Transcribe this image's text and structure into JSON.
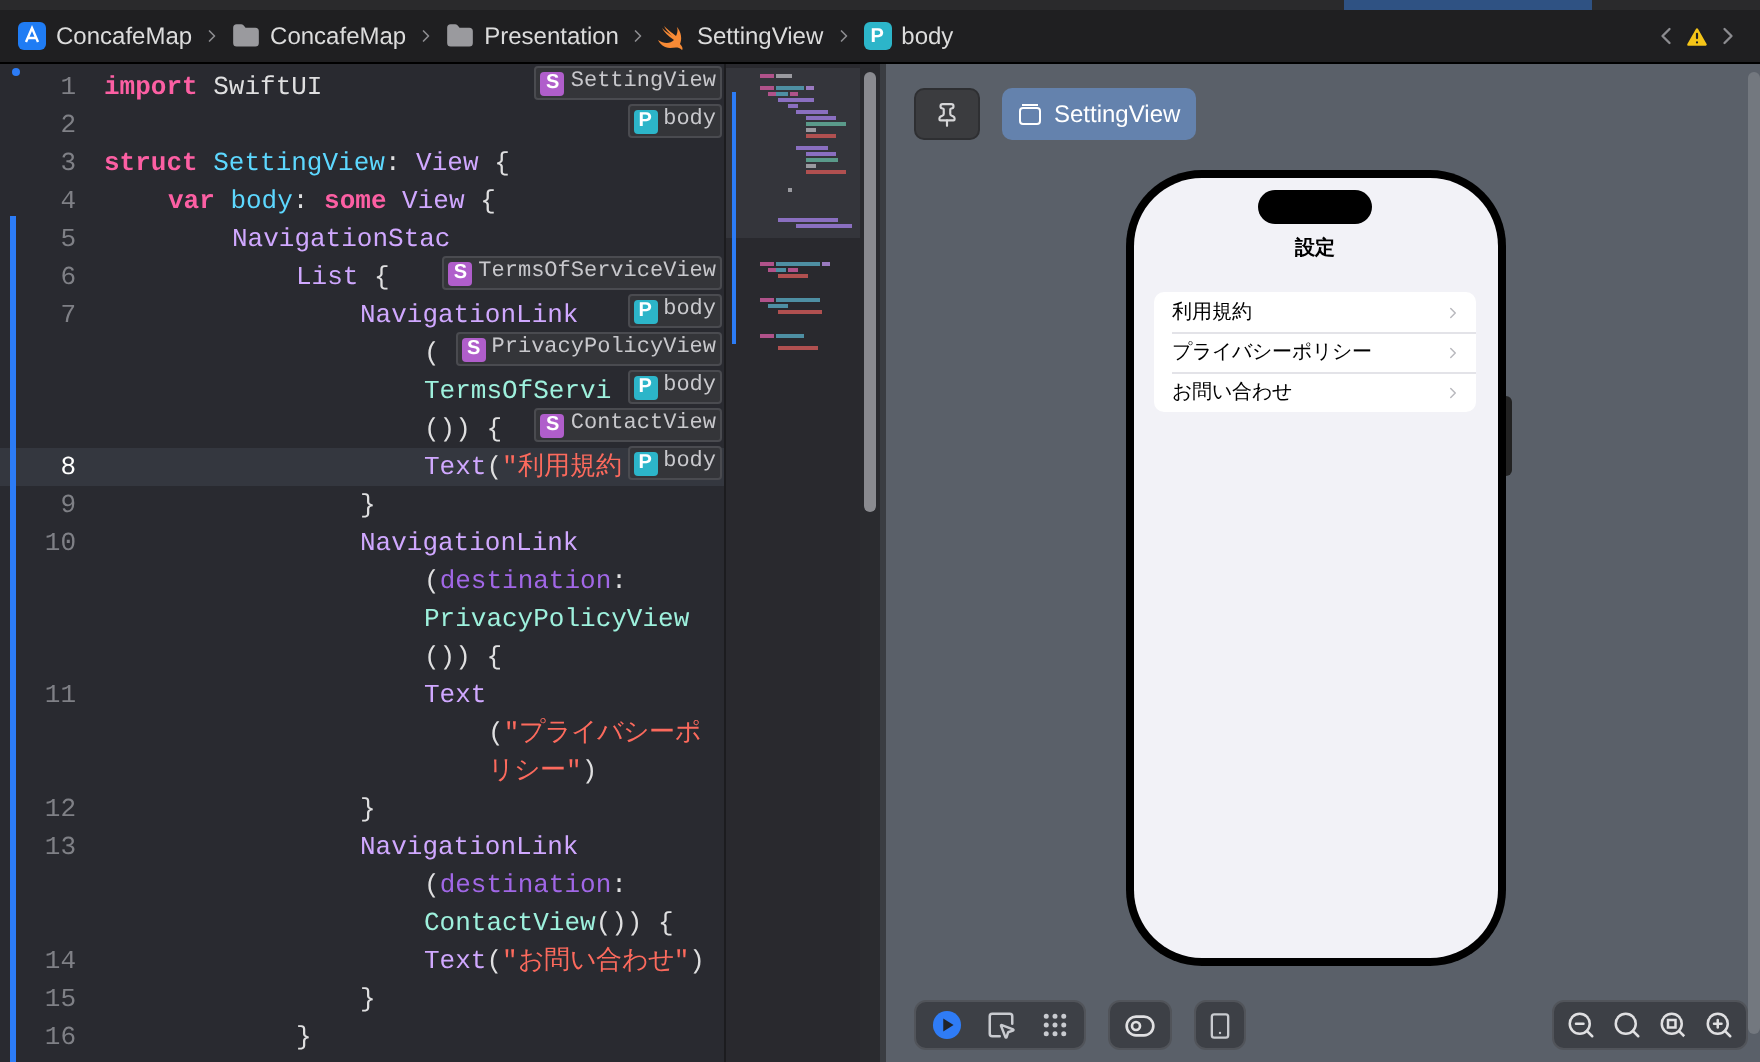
{
  "breadcrumbs": [
    {
      "kind": "project",
      "label": "ConcafeMap"
    },
    {
      "kind": "folder",
      "label": "ConcafeMap"
    },
    {
      "kind": "folder",
      "label": "Presentation"
    },
    {
      "kind": "swift",
      "label": "SettingView"
    },
    {
      "kind": "property",
      "badge": "P",
      "label": "body"
    }
  ],
  "editor": {
    "rows": [
      {
        "number": "1",
        "current": false,
        "segments": [
          {
            "kind": "keyword",
            "text": "import"
          },
          {
            "kind": "plain",
            "text": " SwiftUI"
          }
        ]
      },
      {
        "number": "2",
        "current": false,
        "segments": []
      },
      {
        "number": "3",
        "current": false,
        "segments": [
          {
            "kind": "keyword",
            "text": "struct"
          },
          {
            "kind": "decl",
            "text": " SettingView"
          },
          {
            "kind": "plain",
            "text": ":"
          },
          {
            "kind": "type",
            "text": " View"
          },
          {
            "kind": "plain",
            "text": " {"
          }
        ]
      },
      {
        "number": "4",
        "current": false,
        "segments": [
          {
            "kind": "keyword",
            "text": "    var"
          },
          {
            "kind": "decl",
            "text": " body"
          },
          {
            "kind": "plain",
            "text": ":"
          },
          {
            "kind": "keyword",
            "text": " some"
          },
          {
            "kind": "type",
            "text": " View"
          },
          {
            "kind": "plain",
            "text": " {"
          }
        ]
      },
      {
        "number": "5",
        "current": false,
        "segments": [
          {
            "kind": "type",
            "text": "        NavigationStac"
          }
        ]
      },
      {
        "number": "6",
        "current": false,
        "segments": [
          {
            "kind": "type",
            "text": "            List"
          },
          {
            "kind": "plain",
            "text": " {"
          }
        ]
      },
      {
        "number": "7",
        "current": false,
        "segments": [
          {
            "kind": "type",
            "text": "                NavigationLink"
          }
        ]
      },
      {
        "segments": [
          {
            "kind": "plain",
            "text": "                    ("
          }
        ]
      },
      {
        "segments": [
          {
            "kind": "project",
            "text": "                    TermsOfServi"
          }
        ]
      },
      {
        "segments": [
          {
            "kind": "plain",
            "text": "                    ()) {"
          }
        ]
      },
      {
        "number": "8",
        "current": true,
        "segments": [
          {
            "kind": "type",
            "text": "                    Text"
          },
          {
            "kind": "plain",
            "text": "("
          },
          {
            "kind": "string",
            "text": "\"利用規約"
          }
        ]
      },
      {
        "number": "9",
        "current": false,
        "segments": [
          {
            "kind": "plain",
            "text": "                }"
          }
        ]
      },
      {
        "number": "10",
        "current": false,
        "segments": [
          {
            "kind": "type",
            "text": "                NavigationLink"
          }
        ]
      },
      {
        "segments": [
          {
            "kind": "plain",
            "text": "                    ("
          },
          {
            "kind": "param",
            "text": "destination"
          },
          {
            "kind": "plain",
            "text": ":"
          }
        ]
      },
      {
        "segments": [
          {
            "kind": "project",
            "text": "                    PrivacyPolicyView"
          }
        ]
      },
      {
        "segments": [
          {
            "kind": "plain",
            "text": "                    ()) {"
          }
        ]
      },
      {
        "number": "11",
        "current": false,
        "segments": [
          {
            "kind": "type",
            "text": "                    Text"
          }
        ]
      },
      {
        "segments": [
          {
            "kind": "plain",
            "text": "                        ("
          },
          {
            "kind": "string",
            "text": "\"プライバシーポ"
          }
        ]
      },
      {
        "segments": [
          {
            "kind": "string",
            "text": "                        リシー\""
          },
          {
            "kind": "plain",
            "text": ")"
          }
        ]
      },
      {
        "number": "12",
        "current": false,
        "segments": [
          {
            "kind": "plain",
            "text": "                }"
          }
        ]
      },
      {
        "number": "13",
        "current": false,
        "segments": [
          {
            "kind": "type",
            "text": "                NavigationLink"
          }
        ]
      },
      {
        "segments": [
          {
            "kind": "plain",
            "text": "                    ("
          },
          {
            "kind": "param",
            "text": "destination"
          },
          {
            "kind": "plain",
            "text": ":"
          }
        ]
      },
      {
        "segments": [
          {
            "kind": "project",
            "text": "                    ContactView"
          },
          {
            "kind": "plain",
            "text": "()) {"
          }
        ]
      },
      {
        "number": "14",
        "current": false,
        "segments": [
          {
            "kind": "type",
            "text": "                    Text"
          },
          {
            "kind": "plain",
            "text": "("
          },
          {
            "kind": "string",
            "text": "\"お問い合わせ\""
          },
          {
            "kind": "plain",
            "text": ")"
          }
        ]
      },
      {
        "number": "15",
        "current": false,
        "segments": [
          {
            "kind": "plain",
            "text": "                }"
          }
        ]
      },
      {
        "number": "16",
        "current": false,
        "segments": [
          {
            "kind": "plain",
            "text": "            }"
          }
        ]
      }
    ],
    "annotations": [
      {
        "kind": "struct",
        "badge": "S",
        "label": "SettingView"
      },
      {
        "kind": "property",
        "badge": "P",
        "label": "body"
      },
      {
        "kind": "struct",
        "badge": "S",
        "label": "TermsOfServiceView"
      },
      {
        "kind": "property",
        "badge": "P",
        "label": "body"
      },
      {
        "kind": "struct",
        "badge": "S",
        "label": "PrivacyPolicyView"
      },
      {
        "kind": "property",
        "badge": "P",
        "label": "body"
      },
      {
        "kind": "struct",
        "badge": "S",
        "label": "ContactView"
      },
      {
        "kind": "property",
        "badge": "P",
        "label": "body"
      }
    ]
  },
  "preview": {
    "view_button": "SettingView",
    "screen": {
      "title": "設定",
      "items": [
        {
          "label": "利用規約"
        },
        {
          "label": "プライバシーポリシー"
        },
        {
          "label": "お問い合わせ"
        }
      ]
    },
    "modes": [
      {
        "kind": "live",
        "selected": true
      },
      {
        "kind": "select",
        "selected": false
      },
      {
        "kind": "variants",
        "selected": false
      }
    ]
  }
}
